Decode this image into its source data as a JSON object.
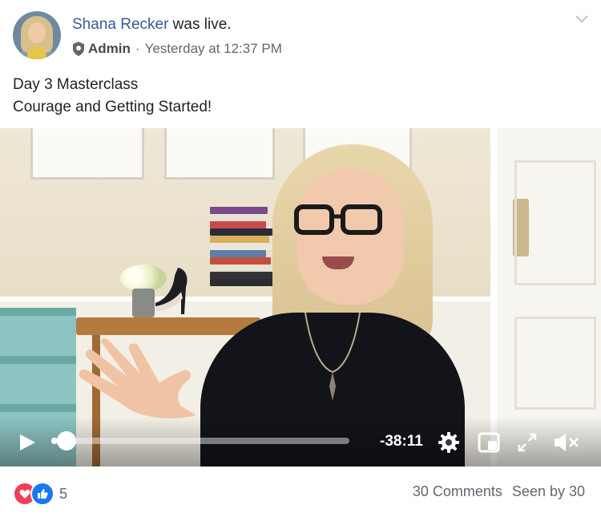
{
  "post": {
    "author": "Shana Recker",
    "action": " was live.",
    "role": "Admin",
    "separator": "·",
    "timestamp": "Yesterday at 12:37 PM",
    "caption_lines": [
      "Day 3 Masterclass",
      "Courage and Getting Started!"
    ]
  },
  "video": {
    "time_remaining": "-38:11",
    "progress_fraction": 0.02,
    "icons": [
      "play-icon",
      "settings-icon",
      "picture-in-picture-icon",
      "fullscreen-icon",
      "muted-volume-icon"
    ]
  },
  "footer": {
    "reaction_count": "5",
    "comments": "30 Comments",
    "seen_by": "Seen by 30"
  },
  "colors": {
    "author_link": "#385898",
    "love": "#f33e58",
    "like": "#1877f2",
    "meta_text": "#606770"
  }
}
